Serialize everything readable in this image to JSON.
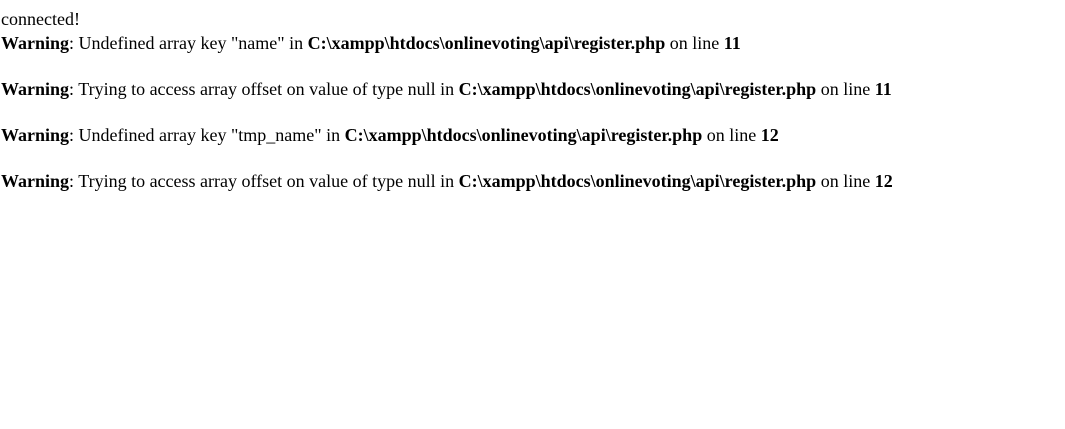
{
  "output": {
    "status_text": "connected!",
    "warnings": [
      {
        "level": "Warning",
        "message": ": Undefined array key \"name\" in ",
        "path": "C:\\xampp\\htdocs\\onlinevoting\\api\\register.php",
        "line_prefix": " on line ",
        "line": "11"
      },
      {
        "level": "Warning",
        "message": ": Trying to access array offset on value of type null in ",
        "path": "C:\\xampp\\htdocs\\onlinevoting\\api\\register.php",
        "line_prefix": " on line ",
        "line": "11"
      },
      {
        "level": "Warning",
        "message": ": Undefined array key \"tmp_name\" in ",
        "path": "C:\\xampp\\htdocs\\onlinevoting\\api\\register.php",
        "line_prefix": " on line ",
        "line": "12"
      },
      {
        "level": "Warning",
        "message": ": Trying to access array offset on value of type null in ",
        "path": "C:\\xampp\\htdocs\\onlinevoting\\api\\register.php",
        "line_prefix": " on line ",
        "line": "12"
      }
    ]
  }
}
